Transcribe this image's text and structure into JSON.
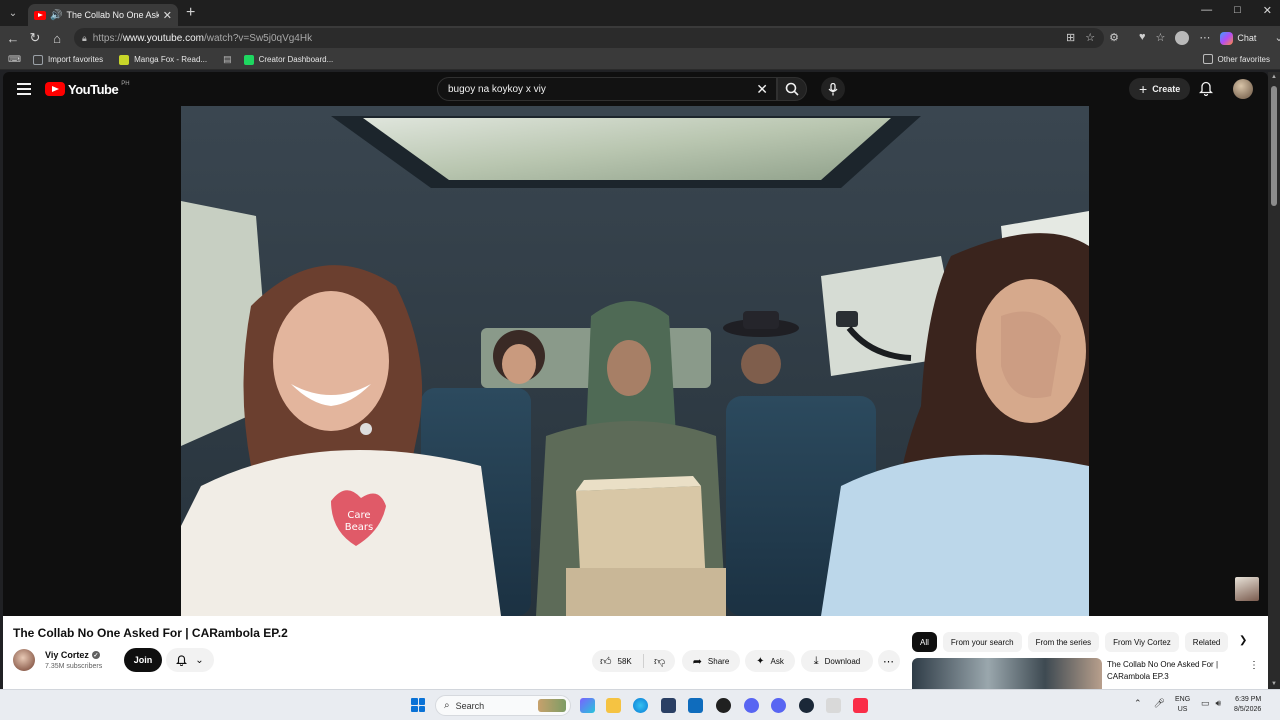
{
  "browser": {
    "tab_title": "The Collab No One Asked For",
    "url_prefix": "https://",
    "url_domain": "www.youtube.com",
    "url_path": "/watch?v=Sw5j0qVg4Hk",
    "copilot_label": "Chat",
    "bookmarks": [
      {
        "label": "Import favorites",
        "color": "#9aa0a6"
      },
      {
        "label": "Manga Fox - Read...",
        "color": "#c8d629"
      },
      {
        "label": "Creator Dashboard...",
        "color": "#1ed760"
      }
    ],
    "other_favorites": "Other favorites"
  },
  "youtube": {
    "logo_text": "YouTube",
    "country_code": "PH",
    "search_value": "bugoy na koykoy x viy",
    "create_label": "Create",
    "video_title": "The Collab No One Asked For | CARambola EP.2",
    "channel_name": "Viy Cortez",
    "subscribers": "7.35M subscribers",
    "join_label": "Join",
    "like_count": "58K",
    "share_label": "Share",
    "ask_label": "Ask",
    "download_label": "Download",
    "chips": [
      "All",
      "From your search",
      "From the series",
      "From Viy Cortez",
      "Related"
    ],
    "recommendation_title": "The Collab No One Asked For | CARambola EP.3",
    "shirt_text_1": "Care",
    "shirt_text_2": "Bears"
  },
  "taskbar": {
    "search_placeholder": "Search",
    "lang_top": "ENG",
    "lang_bottom": "US",
    "time": "6:39 PM",
    "date": "8/5/2026"
  },
  "colors": {
    "youtube_red": "#ff0000",
    "yt_background": "#0f0f0f",
    "browser_chrome": "#3a3a3a",
    "taskbar_bg": "#e9ecf1"
  }
}
